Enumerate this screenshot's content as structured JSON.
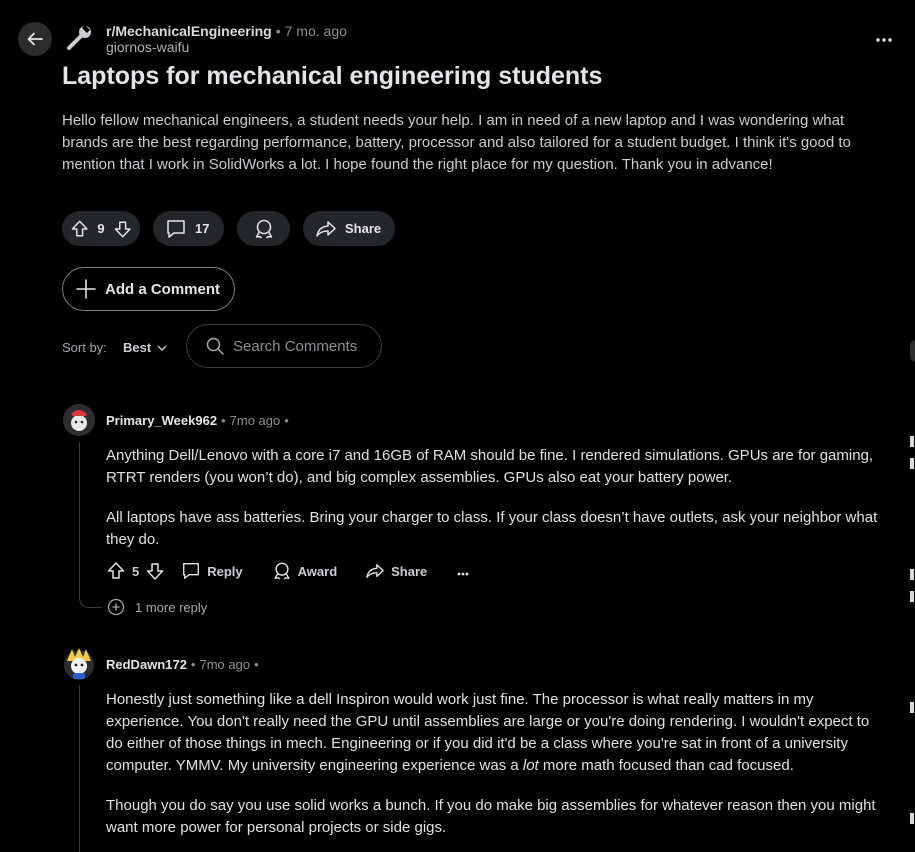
{
  "post": {
    "subreddit": "r/MechanicalEngineering",
    "time": "7 mo. ago",
    "author": "giornos-waifu",
    "title": "Laptops for mechanical engineering students",
    "body": "Hello fellow mechanical engineers, a student needs your help. I am in need of a new laptop and I was wondering what brands are the best regarding performance, battery, processor and also tailored for a student budget. I think it's good to mention that I work in SolidWorks a lot. I hope found the right place for my question. Thank you in advance!",
    "votes": "9",
    "comments_count": "17",
    "share_label": "Share"
  },
  "add_comment_label": "Add a Comment",
  "sort": {
    "label": "Sort by:",
    "value": "Best"
  },
  "search": {
    "placeholder": "Search Comments"
  },
  "comments": [
    {
      "user": "Primary_Week962",
      "time": "7mo ago",
      "paragraphs": [
        "Anything Dell/Lenovo with a core i7 and 16GB of RAM should be fine. I rendered simulations. GPUs are for gaming, RTRT renders (you won’t do), and big complex assemblies. GPUs also eat your battery power.",
        "All laptops have ass batteries. Bring your charger to class. If your class doesn’t have outlets, ask your neighbor what they do."
      ],
      "votes": "5",
      "reply_label": "Reply",
      "award_label": "Award",
      "share_label": "Share",
      "more_replies": "1 more reply"
    },
    {
      "user": "RedDawn172",
      "time": "7mo ago",
      "p1_before": "Honestly just something like a dell Inspiron would work just fine. The processor is what really matters in my experience. You don't really need the GPU until assemblies are large or you're doing rendering. I wouldn't expect to do either of those things in mech. Engineering or if you did it'd be a class where you're sat in front of a university computer. YMMV. My university engineering experience was a ",
      "p1_italic": "lot",
      "p1_after": " more math focused than cad focused.",
      "p2": "Though you do say you use solid works a bunch. If you do make big assemblies for whatever reason then you might want more power for personal projects or side gigs."
    }
  ],
  "colors": {
    "background": "#000000",
    "pill": "#24272a",
    "text": "#d7dadc",
    "muted": "#8a8f94"
  }
}
